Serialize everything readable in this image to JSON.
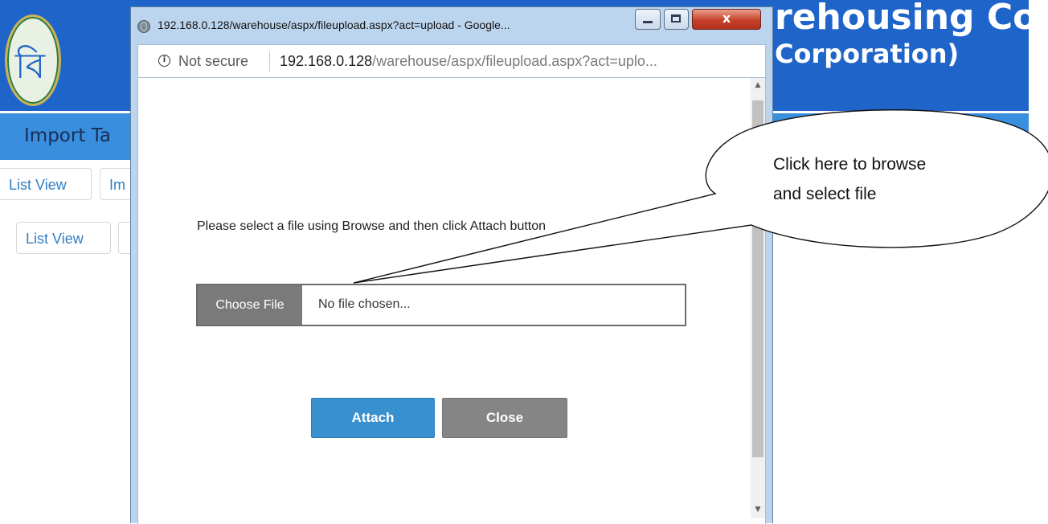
{
  "background": {
    "header_title_line1": "rehousing Co",
    "header_title_line2": "Corporation)",
    "logo_glyph": "বি",
    "nav_title": "Import Ta",
    "tab_buttons": [
      "List View",
      "Im"
    ],
    "action_buttons": [
      "List View"
    ],
    "header_color": "#1f64c9",
    "nav_color": "#3a8ede"
  },
  "popup": {
    "window_title": "192.168.0.128/warehouse/aspx/fileupload.aspx?act=upload - Google...",
    "close_glyph": "x",
    "address_bar": {
      "security_label": "Not secure",
      "url_host": "192.168.0.128",
      "url_path": "/warehouse/aspx/fileupload.aspx?act=uplo..."
    },
    "instruction": "Please select a file using Browse and then click Attach button",
    "file_input": {
      "button_label": "Choose File",
      "value": "No file chosen..."
    },
    "attach_label": "Attach",
    "close_label": "Close",
    "attach_color": "#3990cf",
    "close_color": "#858585"
  },
  "callout": {
    "line1": "Click here to browse",
    "line2": "and select file"
  }
}
